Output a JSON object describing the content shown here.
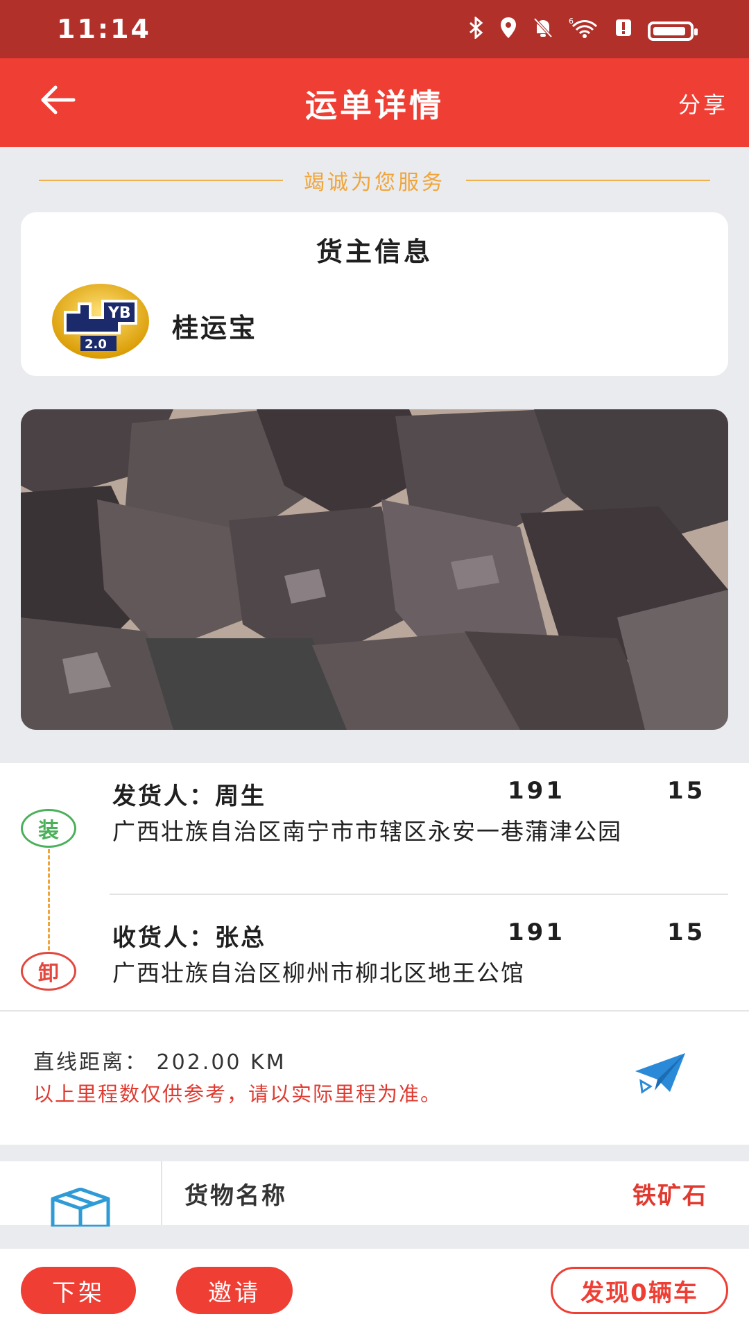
{
  "status_bar": {
    "time": "11:14",
    "icons": [
      "bluetooth-icon",
      "location-icon",
      "mute-icon",
      "wifi-icon",
      "alert-icon",
      "battery-icon"
    ],
    "network_tag": "6"
  },
  "header": {
    "title": "运单详情",
    "share_label": "分享",
    "accent_color": "#ef3f35"
  },
  "slogan": "竭诚为您服务",
  "owner": {
    "heading": "货主信息",
    "name": "桂运宝",
    "logo_text": "2.0"
  },
  "route": {
    "load_badge": "装",
    "unload_badge": "卸",
    "sender": {
      "label": "发货人：周生",
      "phone_start": "191",
      "phone_end": "15",
      "address": "广西壮族自治区南宁市市辖区永安一巷蒲津公园"
    },
    "receiver": {
      "label": "收货人：张总",
      "phone_start": "191",
      "phone_end": "15",
      "address": "广西壮族自治区柳州市柳北区地王公馆"
    }
  },
  "distance": {
    "label": "直线距离： 202.00 KM",
    "note": "以上里程数仅供参考，请以实际里程为准。"
  },
  "cargo": {
    "label": "货物名称",
    "value": "铁矿石"
  },
  "actions": {
    "delist_label": "下架",
    "invite_label": "邀请",
    "found_label": "发现0辆车"
  }
}
